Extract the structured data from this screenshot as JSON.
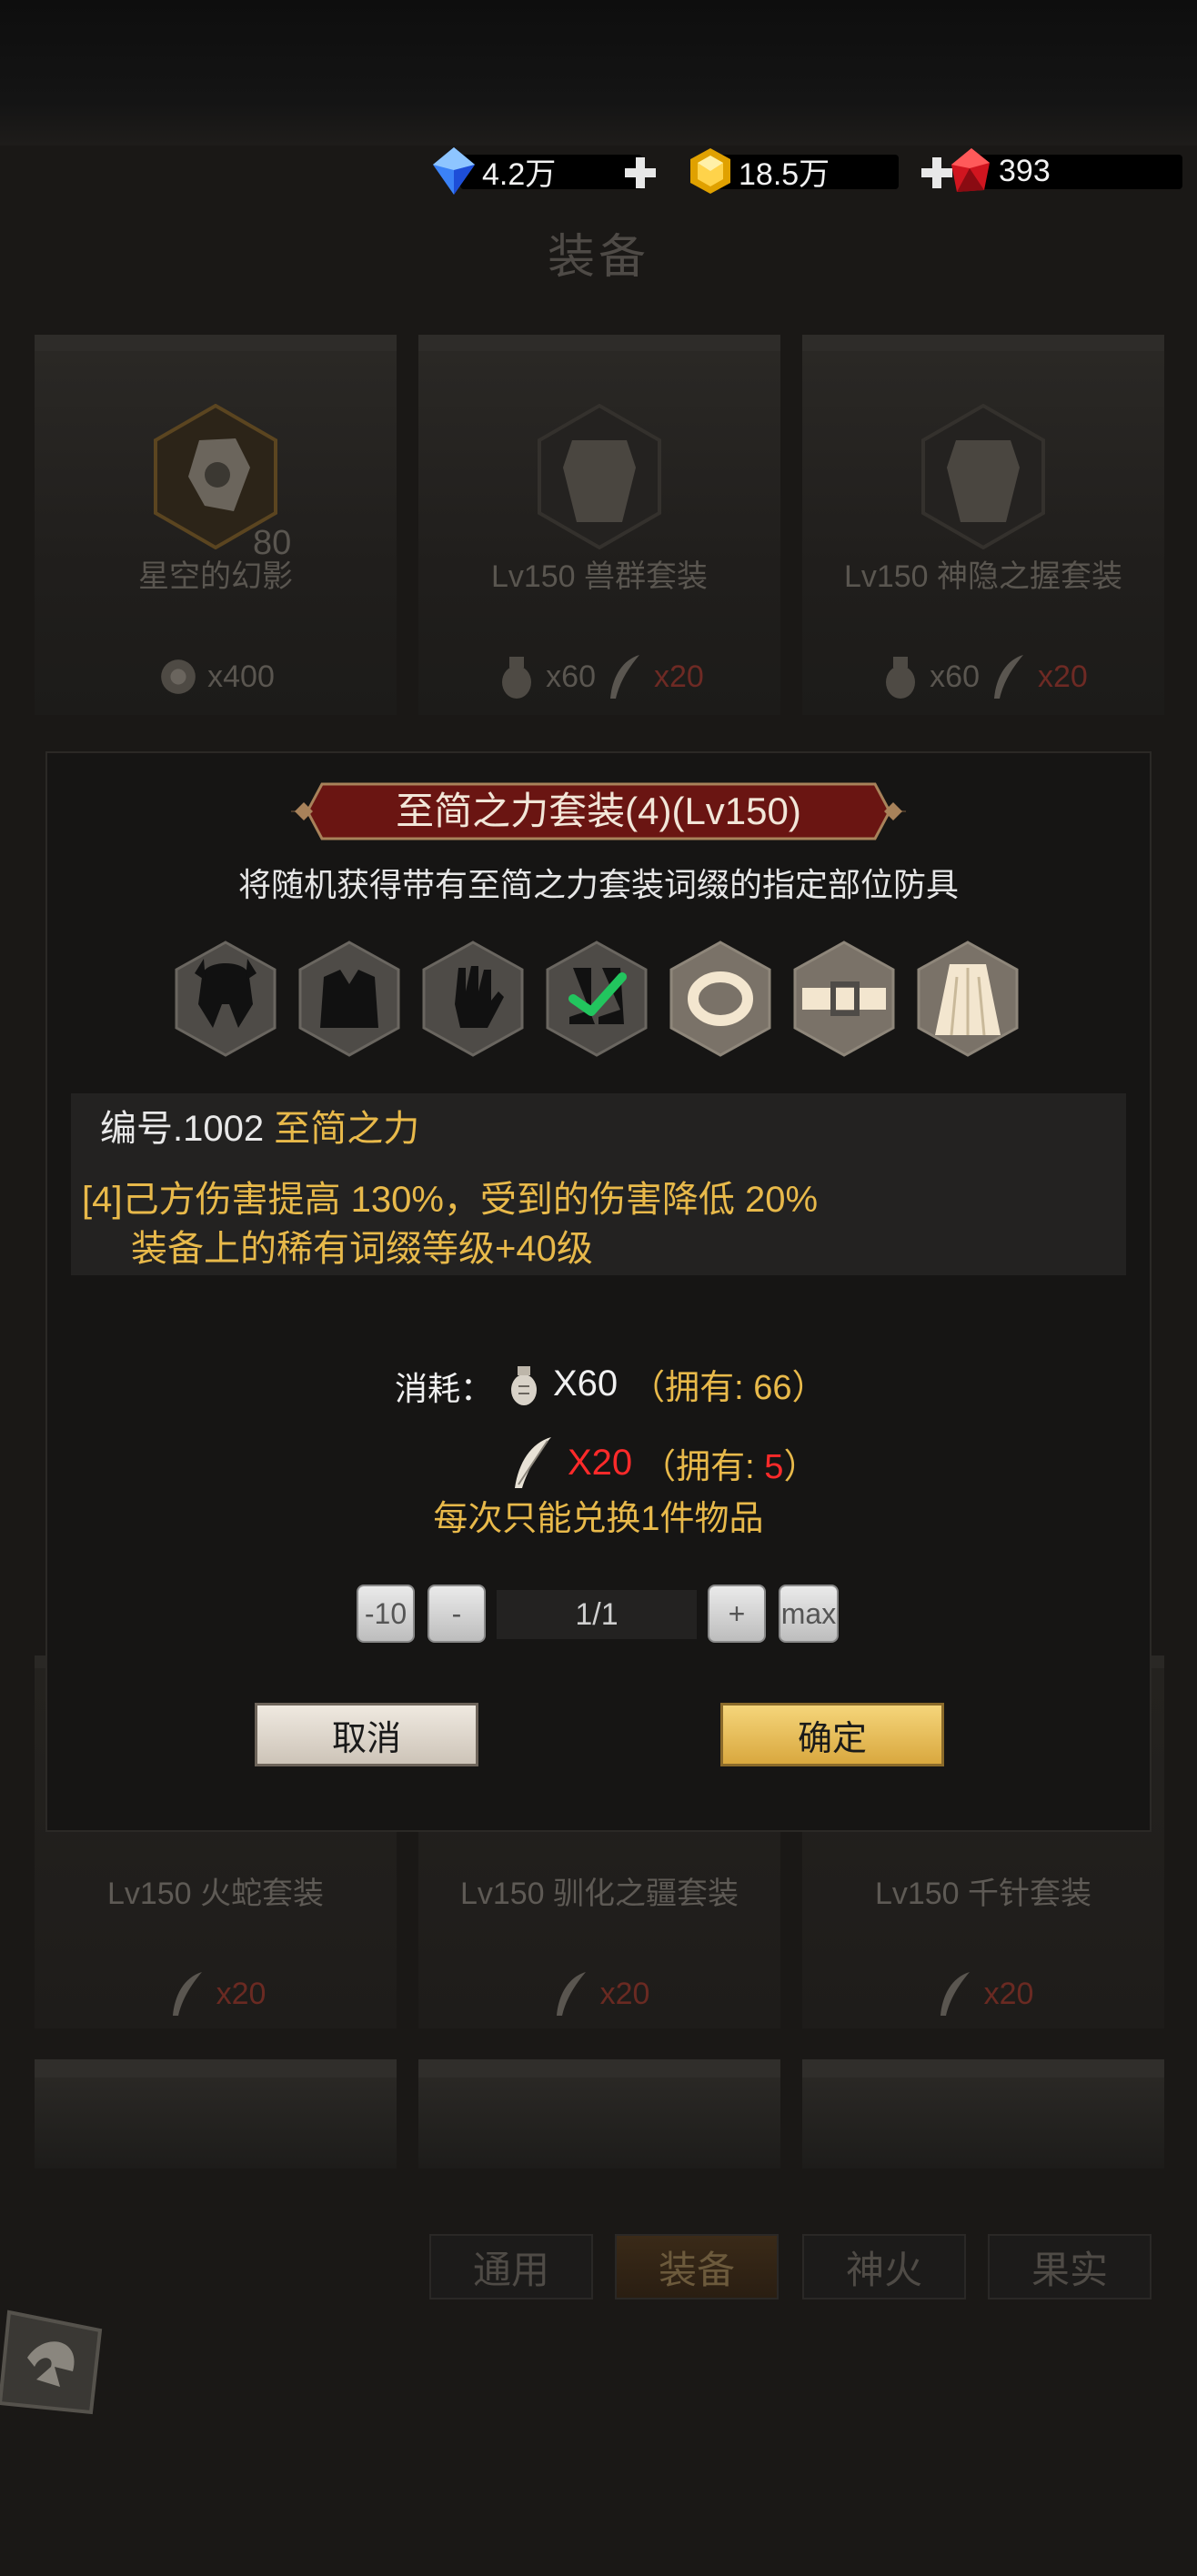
{
  "currency": {
    "diamond": "4.2万",
    "gold": "18.5万",
    "ruby": "393"
  },
  "page_title": "装备",
  "cards_row1": [
    {
      "level": "80",
      "name": "星空的幻影",
      "costs": [
        {
          "amount": "x400",
          "red": false
        }
      ]
    },
    {
      "level": "",
      "name": "Lv150 兽群套装",
      "costs": [
        {
          "amount": "x60",
          "red": false
        },
        {
          "amount": "x20",
          "red": true
        }
      ]
    },
    {
      "level": "",
      "name": "Lv150 神隐之握套装",
      "costs": [
        {
          "amount": "x60",
          "red": false
        },
        {
          "amount": "x20",
          "red": true
        }
      ]
    }
  ],
  "cards_row4": [
    {
      "name": "Lv150 火蛇套装",
      "cost": "x20"
    },
    {
      "name": "Lv150 驯化之疆套装",
      "cost": "x20"
    },
    {
      "name": "Lv150 千针套装",
      "cost": "x20"
    }
  ],
  "tabs": [
    {
      "label": "通用",
      "active": false
    },
    {
      "label": "装备",
      "active": true
    },
    {
      "label": "神火",
      "active": false
    },
    {
      "label": "果实",
      "active": false
    }
  ],
  "dialog": {
    "title": "至简之力套装(4)(Lv150)",
    "description": "将随机获得带有至简之力套装词缀的指定部位防具",
    "slots": [
      {
        "icon": "helmet-icon",
        "selected": false
      },
      {
        "icon": "armor-icon",
        "selected": false
      },
      {
        "icon": "glove-icon",
        "selected": false
      },
      {
        "icon": "boots-icon",
        "selected": true
      },
      {
        "icon": "ring-icon",
        "selected": false
      },
      {
        "icon": "belt-icon",
        "selected": false
      },
      {
        "icon": "cloak-icon",
        "selected": false
      }
    ],
    "set_id_label": "编号.1002",
    "set_name": "至简之力",
    "bonus_line1": "[4]己方伤害提高 130%，受到的伤害降低 20%",
    "bonus_line2": "装备上的稀有词缀等级+40级",
    "cost_label": "消耗：",
    "cost1_amount": "X60",
    "cost1_owned": "（拥有: 66）",
    "cost2_amount": "X20",
    "cost2_owned_prefix": "（拥有: ",
    "cost2_owned_value": "5",
    "cost2_owned_suffix": "）",
    "limit_note": "每次只能兑换1件物品",
    "qty_minus10": "-10",
    "qty_minus": "-",
    "qty_value": "1/1",
    "qty_plus": "+",
    "qty_max": "max",
    "cancel_label": "取消",
    "confirm_label": "确定"
  },
  "colors": {
    "accent_gold": "#e8b94a",
    "warning_red": "#ff2a2a",
    "title_red": "#6a1512"
  }
}
